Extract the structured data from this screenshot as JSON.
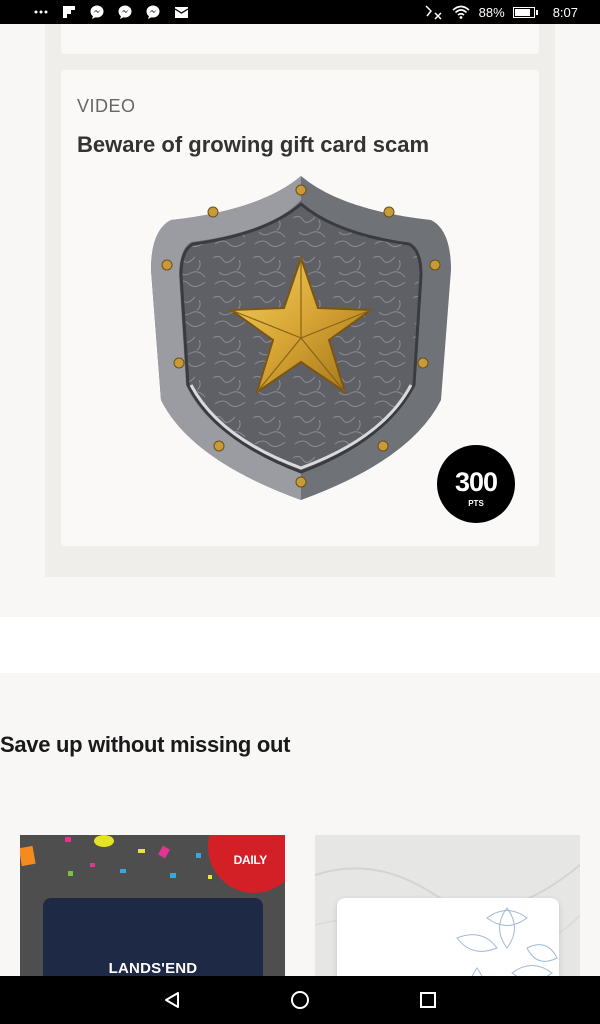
{
  "status_bar": {
    "battery_percent": "88%",
    "battery_level": 0.88,
    "time": "8:07",
    "notification_icons": [
      "more-icon",
      "flipboard-icon",
      "messenger-icon",
      "messenger-icon",
      "messenger-icon",
      "email-icon"
    ],
    "system_icons": [
      "bluetooth-off-icon",
      "wifi-icon",
      "battery-icon"
    ]
  },
  "feed_card": {
    "kicker": "VIDEO",
    "title": "Beware of growing gift card scam",
    "image": "shield-star-icon",
    "points_value": "300",
    "points_unit": "PTS"
  },
  "savings_section": {
    "title": "Save up without missing out",
    "promos": [
      {
        "badge": "DAILY",
        "brand": "LANDS'END"
      },
      {
        "badge": "",
        "brand": ""
      }
    ]
  },
  "nav_bar": {
    "buttons": [
      "back-icon",
      "home-icon",
      "recents-icon"
    ]
  },
  "colors": {
    "badge_black": "#000000",
    "daily_red": "#d32027",
    "card_navy": "#1e2a45",
    "shield_gold": "#d7a534"
  }
}
